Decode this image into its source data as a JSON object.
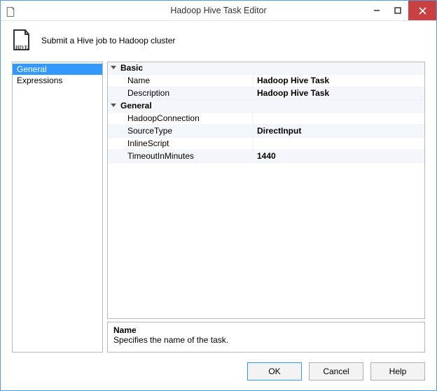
{
  "window": {
    "title": "Hadoop Hive Task Editor",
    "description": "Submit a Hive job to Hadoop cluster"
  },
  "nav": {
    "items": [
      {
        "label": "General",
        "selected": true
      },
      {
        "label": "Expressions",
        "selected": false
      }
    ]
  },
  "propgrid": {
    "categories": [
      {
        "label": "Basic",
        "rows": [
          {
            "name": "Name",
            "value": "Hadoop Hive Task"
          },
          {
            "name": "Description",
            "value": "Hadoop Hive Task"
          }
        ]
      },
      {
        "label": "General",
        "rows": [
          {
            "name": "HadoopConnection",
            "value": ""
          },
          {
            "name": "SourceType",
            "value": "DirectInput"
          },
          {
            "name": "InlineScript",
            "value": ""
          },
          {
            "name": "TimeoutInMinutes",
            "value": "1440"
          }
        ]
      }
    ]
  },
  "help": {
    "title": "Name",
    "text": "Specifies the name of the task."
  },
  "buttons": {
    "ok": "OK",
    "cancel": "Cancel",
    "help": "Help"
  }
}
